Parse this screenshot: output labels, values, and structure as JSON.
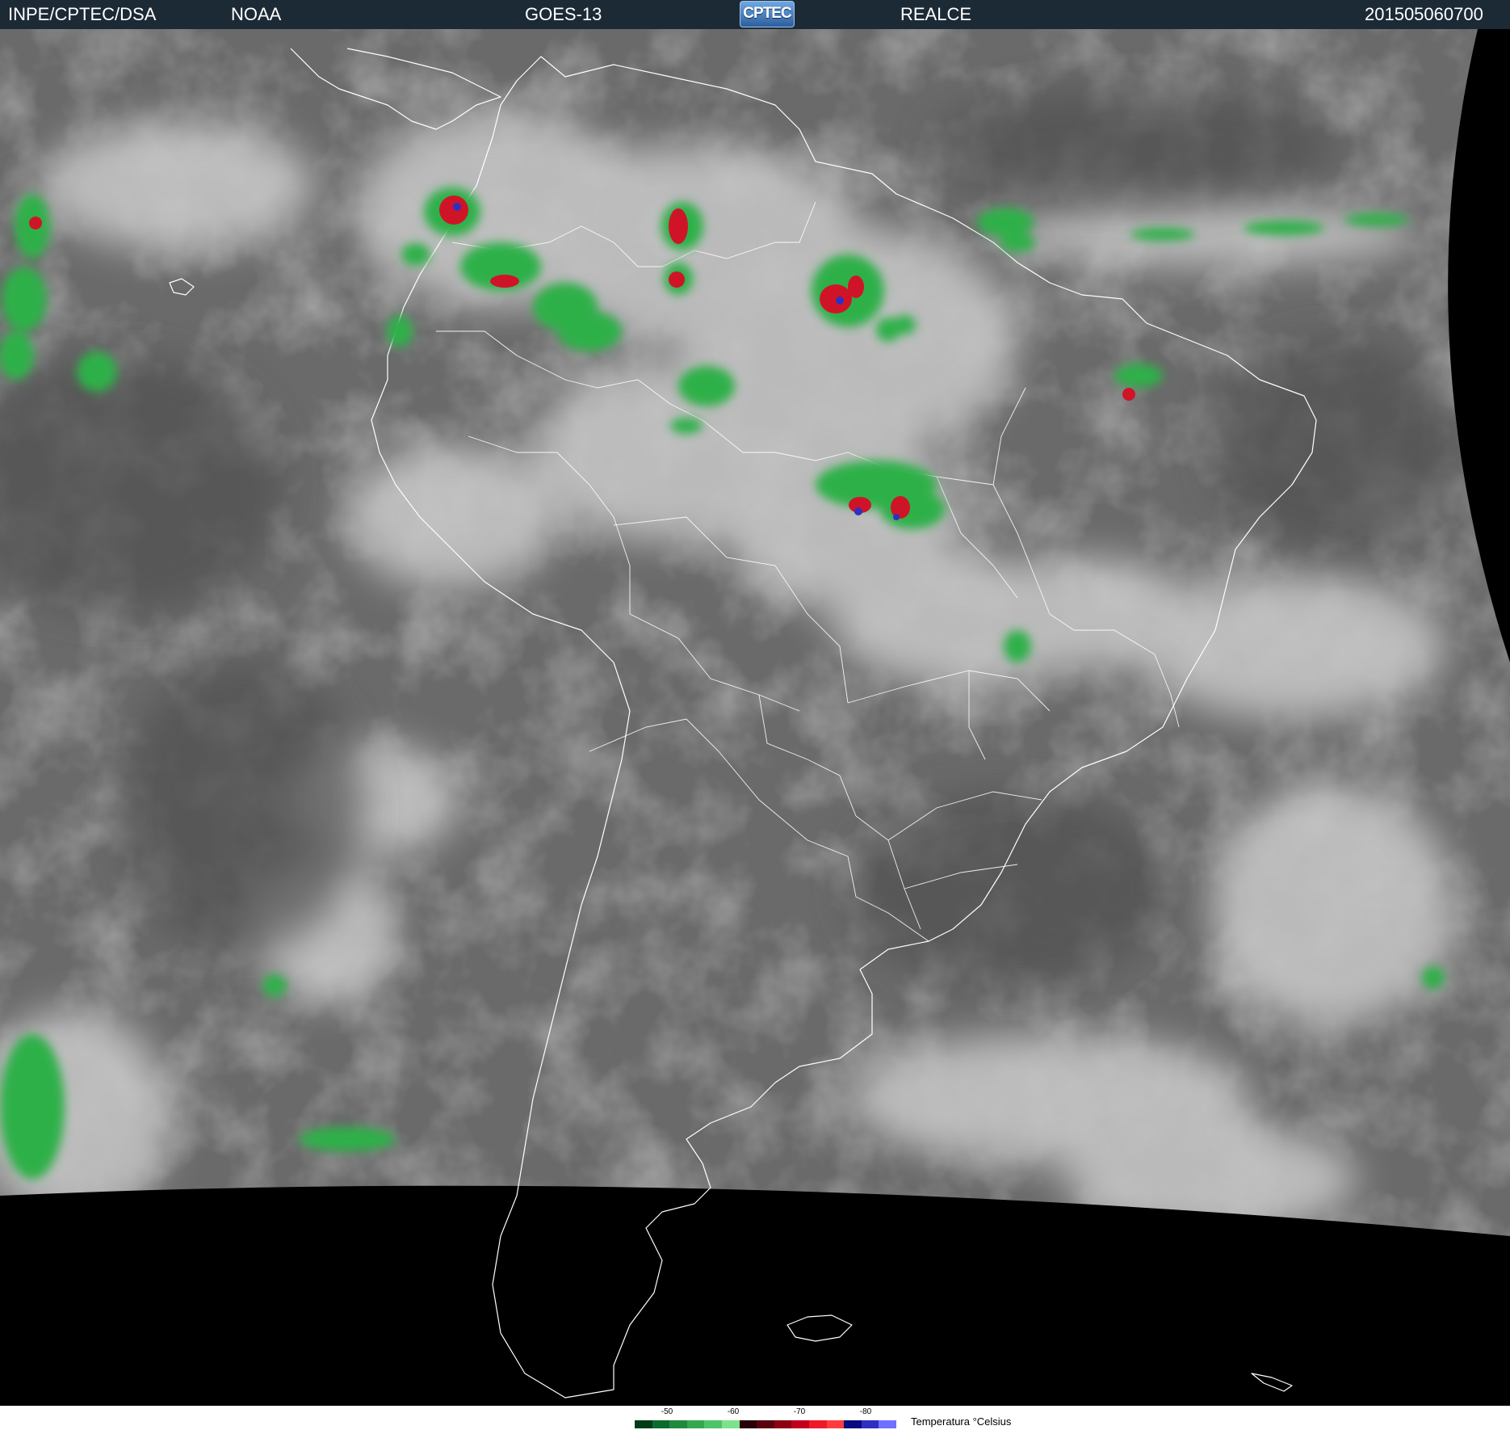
{
  "header": {
    "left": "INPE/CPTEC/DSA",
    "agency": "NOAA",
    "satellite": "GOES-13",
    "logo_text": "CPTEC",
    "product": "REALCE",
    "timestamp": "201505060700"
  },
  "legend": {
    "title": "Temperatura °Celsius",
    "ticks": [
      "-50",
      "-60",
      "-70",
      "-80"
    ],
    "colors": [
      "#003c18",
      "#0d6a2e",
      "#1f8a3e",
      "#35a84f",
      "#4ec46a",
      "#7ee28c",
      "#260006",
      "#5a000e",
      "#8c0014",
      "#c0001c",
      "#ee1a2a",
      "#ff3c3c",
      "#0a0a80",
      "#3030c0",
      "#7070ff"
    ]
  },
  "colors": {
    "header_bg": "#1c2a36",
    "background_ir": "#6a6a6a",
    "coastline": "#ffffff",
    "outside_disk": "#000000",
    "cold_green": "#2fb04a",
    "cold_red": "#d01428",
    "cold_blue": "#3030c0"
  }
}
